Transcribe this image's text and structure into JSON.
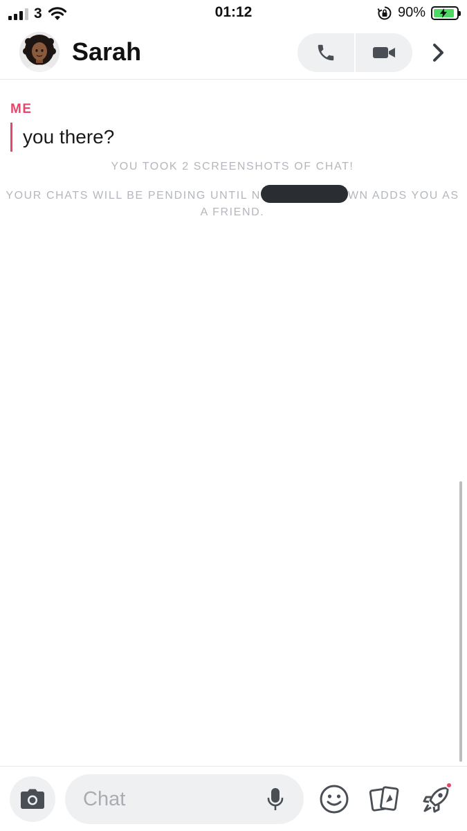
{
  "status_bar": {
    "carrier": "3",
    "time": "01:12",
    "battery_percent": "90%",
    "battery_level": 0.9,
    "charging": true
  },
  "header": {
    "contact_name": "Sarah",
    "avatar_icon": "bitmoji-avatar",
    "call_icon": "phone-icon",
    "video_icon": "video-camera-icon",
    "more_icon": "chevron-right-icon"
  },
  "messages": [
    {
      "sender": "ME",
      "text": "you there?"
    }
  ],
  "notices": {
    "screenshot": "YOU TOOK 2 SCREENSHOTS OF CHAT!",
    "pending_prefix": "YOUR CHATS WILL BE PENDING UNTIL N",
    "pending_suffix": "WN ADDS YOU AS A FRIEND."
  },
  "bottom_bar": {
    "chat_placeholder": "Chat",
    "camera_icon": "camera-icon",
    "mic_icon": "microphone-icon",
    "emoji_icon": "smiley-icon",
    "cards_icon": "cards-icon",
    "games_icon": "rocket-icon"
  },
  "colors": {
    "accent": "#e8456b",
    "notice_text": "#b3b7bd",
    "pill_background": "#eef0f2",
    "battery": "#4cd964"
  }
}
